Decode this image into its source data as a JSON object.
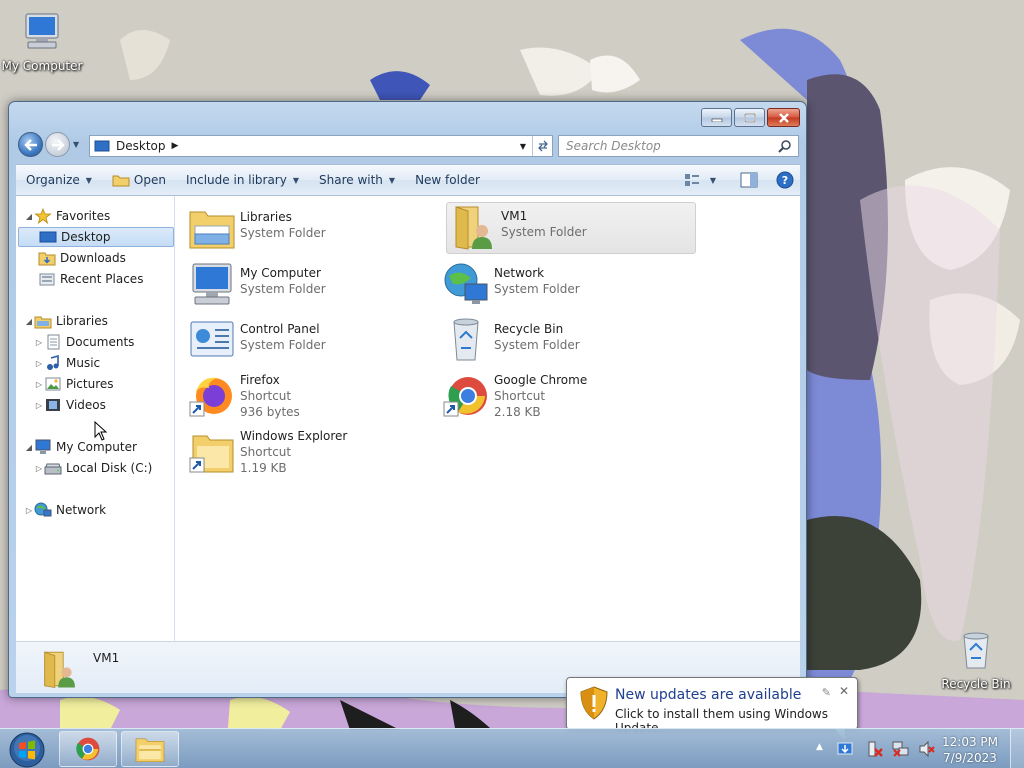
{
  "desktop": {
    "icons": [
      {
        "label": "My Computer",
        "icon": "computer-icon"
      },
      {
        "label": "Recycle Bin",
        "icon": "recycle-bin-icon"
      }
    ]
  },
  "window": {
    "address": {
      "location": "Desktop"
    },
    "search": {
      "placeholder": "Search Desktop"
    },
    "toolbar": {
      "organize": "Organize",
      "open": "Open",
      "include_in_library": "Include in library",
      "share_with": "Share with",
      "new_folder": "New folder"
    },
    "nav_tree": {
      "favorites": "Favorites",
      "desktop": "Desktop",
      "downloads": "Downloads",
      "recent_places": "Recent Places",
      "libraries": "Libraries",
      "documents": "Documents",
      "music": "Music",
      "pictures": "Pictures",
      "videos": "Videos",
      "my_computer": "My Computer",
      "local_disk": "Local Disk (C:)",
      "network": "Network"
    },
    "files": [
      {
        "name": "Libraries",
        "type": "System Folder",
        "size": ""
      },
      {
        "name": "VM1",
        "type": "System Folder",
        "size": "",
        "selected": true
      },
      {
        "name": "My Computer",
        "type": "System Folder",
        "size": ""
      },
      {
        "name": "Network",
        "type": "System Folder",
        "size": ""
      },
      {
        "name": "Control Panel",
        "type": "System Folder",
        "size": ""
      },
      {
        "name": "Recycle Bin",
        "type": "System Folder",
        "size": ""
      },
      {
        "name": "Firefox",
        "type": "Shortcut",
        "size": "936 bytes"
      },
      {
        "name": "Google Chrome",
        "type": "Shortcut",
        "size": "2.18 KB"
      },
      {
        "name": "Windows Explorer",
        "type": "Shortcut",
        "size": "1.19 KB"
      }
    ],
    "details": {
      "name": "VM1"
    }
  },
  "notification": {
    "title": "New updates are available",
    "text": "Click to install them using Windows Update."
  },
  "taskbar": {
    "pinned": [
      "chrome-icon",
      "windows-explorer-icon"
    ],
    "clock": {
      "time": "12:03 PM",
      "date": "7/9/2023"
    }
  },
  "colors": {
    "selection": "#c4dcf5",
    "notification_title": "#1f3f8f",
    "window_frame": "#b0cae6"
  }
}
